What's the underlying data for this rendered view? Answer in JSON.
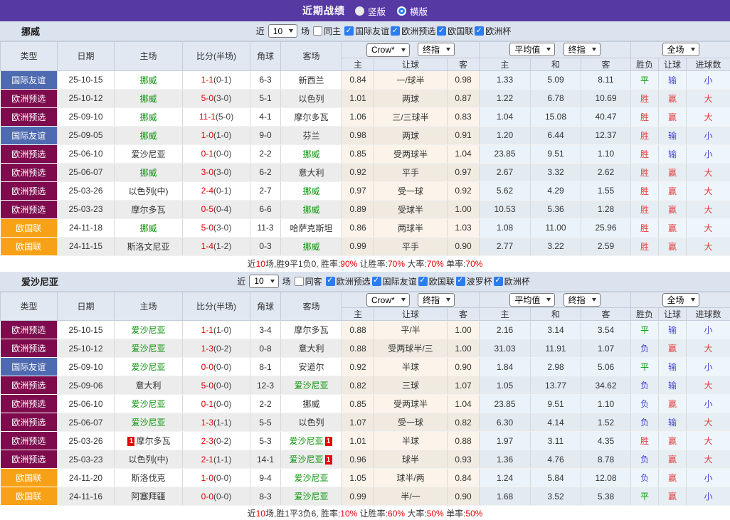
{
  "title_bar": {
    "title": "近期战绩",
    "options": [
      {
        "label": "竖版",
        "selected": true
      },
      {
        "label": "横版",
        "selected": false
      }
    ]
  },
  "colors": {
    "titlebar_bg": "#5639a3",
    "filterbar_bg": "#dbe3ee",
    "header_bg": "#e1e8f2",
    "checkbox_accent": "#2b7cf0",
    "badge": {
      "国际友谊": "#4e6ab0",
      "欧洲预选": "#7d0b4d",
      "欧国联": "#f7a216"
    },
    "team_highlight": "#089408",
    "score_red": "#e60000",
    "result_win": "#e03e3e",
    "result_draw": "#089408",
    "result_loss": "#4444d4"
  },
  "sections": [
    {
      "team": "挪威",
      "filter": {
        "near": "近",
        "count": "10",
        "unit": "场",
        "same_label": "同主",
        "same_checked": false,
        "competitions": [
          {
            "label": "国际友谊",
            "checked": true
          },
          {
            "label": "欧洲预选",
            "checked": true
          },
          {
            "label": "欧国联",
            "checked": true
          },
          {
            "label": "欧洲杯",
            "checked": true
          }
        ]
      },
      "header": {
        "col_type": "类型",
        "col_date": "日期",
        "col_home": "主场",
        "col_score": "比分(半场)",
        "col_corner": "角球",
        "col_away": "客场",
        "select_crow": "Crow*",
        "select_final1": "终指",
        "select_avg": "平均值",
        "select_final2": "终指",
        "select_scope": "全场",
        "sub_home": "主",
        "sub_handicap": "让球",
        "sub_away": "客",
        "sub_avg_home": "主",
        "sub_avg_draw": "和",
        "sub_avg_away": "客",
        "sub_result": "胜负",
        "sub_handicap_result": "让球",
        "sub_goals": "进球数"
      },
      "rows": [
        {
          "type": "国际友谊",
          "date": "25-10-15",
          "home": "挪威",
          "home_green": true,
          "home_red": "",
          "score": "1-1",
          "half": "(0-1)",
          "corners": "6-3",
          "away": "新西兰",
          "away_green": false,
          "away_red": "",
          "odds_home": "0.84",
          "handicap": "一/球半",
          "odds_away": "0.98",
          "avg_home": "1.33",
          "avg_draw": "5.09",
          "avg_away": "8.11",
          "result": "平",
          "handicap_result": "输",
          "goals": "小"
        },
        {
          "type": "欧洲预选",
          "date": "25-10-12",
          "home": "挪威",
          "home_green": true,
          "home_red": "",
          "score": "5-0",
          "half": "(3-0)",
          "corners": "5-1",
          "away": "以色列",
          "away_green": false,
          "away_red": "",
          "odds_home": "1.01",
          "handicap": "两球",
          "odds_away": "0.87",
          "avg_home": "1.22",
          "avg_draw": "6.78",
          "avg_away": "10.69",
          "result": "胜",
          "handicap_result": "赢",
          "goals": "大"
        },
        {
          "type": "欧洲预选",
          "date": "25-09-10",
          "home": "挪威",
          "home_green": true,
          "home_red": "",
          "score": "11-1",
          "half": "(5-0)",
          "corners": "4-1",
          "away": "摩尔多瓦",
          "away_green": false,
          "away_red": "",
          "odds_home": "1.06",
          "handicap": "三/三球半",
          "odds_away": "0.83",
          "avg_home": "1.04",
          "avg_draw": "15.08",
          "avg_away": "40.47",
          "result": "胜",
          "handicap_result": "赢",
          "goals": "大"
        },
        {
          "type": "国际友谊",
          "date": "25-09-05",
          "home": "挪威",
          "home_green": true,
          "home_red": "",
          "score": "1-0",
          "half": "(1-0)",
          "corners": "9-0",
          "away": "芬兰",
          "away_green": false,
          "away_red": "",
          "odds_home": "0.98",
          "handicap": "两球",
          "odds_away": "0.91",
          "avg_home": "1.20",
          "avg_draw": "6.44",
          "avg_away": "12.37",
          "result": "胜",
          "handicap_result": "输",
          "goals": "小"
        },
        {
          "type": "欧洲预选",
          "date": "25-06-10",
          "home": "爱沙尼亚",
          "home_green": false,
          "home_red": "",
          "score": "0-1",
          "half": "(0-0)",
          "corners": "2-2",
          "away": "挪威",
          "away_green": true,
          "away_red": "",
          "odds_home": "0.85",
          "handicap": "受两球半",
          "odds_away": "1.04",
          "avg_home": "23.85",
          "avg_draw": "9.51",
          "avg_away": "1.10",
          "result": "胜",
          "handicap_result": "输",
          "goals": "小"
        },
        {
          "type": "欧洲预选",
          "date": "25-06-07",
          "home": "挪威",
          "home_green": true,
          "home_red": "",
          "score": "3-0",
          "half": "(3-0)",
          "corners": "6-2",
          "away": "意大利",
          "away_green": false,
          "away_red": "",
          "odds_home": "0.92",
          "handicap": "平手",
          "odds_away": "0.97",
          "avg_home": "2.67",
          "avg_draw": "3.32",
          "avg_away": "2.62",
          "result": "胜",
          "handicap_result": "赢",
          "goals": "大"
        },
        {
          "type": "欧洲预选",
          "date": "25-03-26",
          "home": "以色列(中)",
          "home_green": false,
          "home_red": "",
          "score": "2-4",
          "half": "(0-1)",
          "corners": "2-7",
          "away": "挪威",
          "away_green": true,
          "away_red": "",
          "odds_home": "0.97",
          "handicap": "受一球",
          "odds_away": "0.92",
          "avg_home": "5.62",
          "avg_draw": "4.29",
          "avg_away": "1.55",
          "result": "胜",
          "handicap_result": "赢",
          "goals": "大"
        },
        {
          "type": "欧洲预选",
          "date": "25-03-23",
          "home": "摩尔多瓦",
          "home_green": false,
          "home_red": "",
          "score": "0-5",
          "half": "(0-4)",
          "corners": "6-6",
          "away": "挪威",
          "away_green": true,
          "away_red": "",
          "odds_home": "0.89",
          "handicap": "受球半",
          "odds_away": "1.00",
          "avg_home": "10.53",
          "avg_draw": "5.36",
          "avg_away": "1.28",
          "result": "胜",
          "handicap_result": "赢",
          "goals": "大"
        },
        {
          "type": "欧国联",
          "date": "24-11-18",
          "home": "挪威",
          "home_green": true,
          "home_red": "",
          "score": "5-0",
          "half": "(3-0)",
          "corners": "11-3",
          "away": "哈萨克斯坦",
          "away_green": false,
          "away_red": "",
          "odds_home": "0.86",
          "handicap": "两球半",
          "odds_away": "1.03",
          "avg_home": "1.08",
          "avg_draw": "11.00",
          "avg_away": "25.96",
          "result": "胜",
          "handicap_result": "赢",
          "goals": "大"
        },
        {
          "type": "欧国联",
          "date": "24-11-15",
          "home": "斯洛文尼亚",
          "home_green": false,
          "home_red": "",
          "score": "1-4",
          "half": "(1-2)",
          "corners": "0-3",
          "away": "挪威",
          "away_green": true,
          "away_red": "",
          "odds_home": "0.99",
          "handicap": "平手",
          "odds_away": "0.90",
          "avg_home": "2.77",
          "avg_draw": "3.22",
          "avg_away": "2.59",
          "result": "胜",
          "handicap_result": "赢",
          "goals": "大"
        }
      ],
      "summary_parts": [
        {
          "t": "近",
          "red": false
        },
        {
          "t": "10",
          "red": true
        },
        {
          "t": "场,胜9平1负0, 胜率:",
          "red": false
        },
        {
          "t": "90%",
          "red": true
        },
        {
          "t": " 让胜率:",
          "red": false
        },
        {
          "t": "70%",
          "red": true
        },
        {
          "t": " 大率:",
          "red": false
        },
        {
          "t": "70%",
          "red": true
        },
        {
          "t": " 单率:",
          "red": false
        },
        {
          "t": "70%",
          "red": true
        }
      ]
    },
    {
      "team": "爱沙尼亚",
      "filter": {
        "near": "近",
        "count": "10",
        "unit": "场",
        "same_label": "同客",
        "same_checked": false,
        "competitions": [
          {
            "label": "欧洲预选",
            "checked": true
          },
          {
            "label": "国际友谊",
            "checked": true
          },
          {
            "label": "欧国联",
            "checked": true
          },
          {
            "label": "波罗杯",
            "checked": true
          },
          {
            "label": "欧洲杯",
            "checked": true
          }
        ]
      },
      "header": {
        "col_type": "类型",
        "col_date": "日期",
        "col_home": "主场",
        "col_score": "比分(半场)",
        "col_corner": "角球",
        "col_away": "客场",
        "select_crow": "Crow*",
        "select_final1": "终指",
        "select_avg": "平均值",
        "select_final2": "终指",
        "select_scope": "全场",
        "sub_home": "主",
        "sub_handicap": "让球",
        "sub_away": "客",
        "sub_avg_home": "主",
        "sub_avg_draw": "和",
        "sub_avg_away": "客",
        "sub_result": "胜负",
        "sub_handicap_result": "让球",
        "sub_goals": "进球数"
      },
      "rows": [
        {
          "type": "欧洲预选",
          "date": "25-10-15",
          "home": "爱沙尼亚",
          "home_green": true,
          "home_red": "",
          "score": "1-1",
          "half": "(1-0)",
          "corners": "3-4",
          "away": "摩尔多瓦",
          "away_green": false,
          "away_red": "",
          "odds_home": "0.88",
          "handicap": "平/半",
          "odds_away": "1.00",
          "avg_home": "2.16",
          "avg_draw": "3.14",
          "avg_away": "3.54",
          "result": "平",
          "handicap_result": "输",
          "goals": "小"
        },
        {
          "type": "欧洲预选",
          "date": "25-10-12",
          "home": "爱沙尼亚",
          "home_green": true,
          "home_red": "",
          "score": "1-3",
          "half": "(0-2)",
          "corners": "0-8",
          "away": "意大利",
          "away_green": false,
          "away_red": "",
          "odds_home": "0.88",
          "handicap": "受两球半/三",
          "odds_away": "1.00",
          "avg_home": "31.03",
          "avg_draw": "11.91",
          "avg_away": "1.07",
          "result": "负",
          "handicap_result": "赢",
          "goals": "大"
        },
        {
          "type": "国际友谊",
          "date": "25-09-10",
          "home": "爱沙尼亚",
          "home_green": true,
          "home_red": "",
          "score": "0-0",
          "half": "(0-0)",
          "corners": "8-1",
          "away": "安道尔",
          "away_green": false,
          "away_red": "",
          "odds_home": "0.92",
          "handicap": "半球",
          "odds_away": "0.90",
          "avg_home": "1.84",
          "avg_draw": "2.98",
          "avg_away": "5.06",
          "result": "平",
          "handicap_result": "输",
          "goals": "小"
        },
        {
          "type": "欧洲预选",
          "date": "25-09-06",
          "home": "意大利",
          "home_green": false,
          "home_red": "",
          "score": "5-0",
          "half": "(0-0)",
          "corners": "12-3",
          "away": "爱沙尼亚",
          "away_green": true,
          "away_red": "",
          "odds_home": "0.82",
          "handicap": "三球",
          "odds_away": "1.07",
          "avg_home": "1.05",
          "avg_draw": "13.77",
          "avg_away": "34.62",
          "result": "负",
          "handicap_result": "输",
          "goals": "大"
        },
        {
          "type": "欧洲预选",
          "date": "25-06-10",
          "home": "爱沙尼亚",
          "home_green": true,
          "home_red": "",
          "score": "0-1",
          "half": "(0-0)",
          "corners": "2-2",
          "away": "挪威",
          "away_green": false,
          "away_red": "",
          "odds_home": "0.85",
          "handicap": "受两球半",
          "odds_away": "1.04",
          "avg_home": "23.85",
          "avg_draw": "9.51",
          "avg_away": "1.10",
          "result": "负",
          "handicap_result": "赢",
          "goals": "小"
        },
        {
          "type": "欧洲预选",
          "date": "25-06-07",
          "home": "爱沙尼亚",
          "home_green": true,
          "home_red": "",
          "score": "1-3",
          "half": "(1-1)",
          "corners": "5-5",
          "away": "以色列",
          "away_green": false,
          "away_red": "",
          "odds_home": "1.07",
          "handicap": "受一球",
          "odds_away": "0.82",
          "avg_home": "6.30",
          "avg_draw": "4.14",
          "avg_away": "1.52",
          "result": "负",
          "handicap_result": "输",
          "goals": "大"
        },
        {
          "type": "欧洲预选",
          "date": "25-03-26",
          "home": "摩尔多瓦",
          "home_green": false,
          "home_red": "1",
          "score": "2-3",
          "half": "(0-2)",
          "corners": "5-3",
          "away": "爱沙尼亚",
          "away_green": true,
          "away_red": "1",
          "odds_home": "1.01",
          "handicap": "半球",
          "odds_away": "0.88",
          "avg_home": "1.97",
          "avg_draw": "3.11",
          "avg_away": "4.35",
          "result": "胜",
          "handicap_result": "赢",
          "goals": "大"
        },
        {
          "type": "欧洲预选",
          "date": "25-03-23",
          "home": "以色列(中)",
          "home_green": false,
          "home_red": "",
          "score": "2-1",
          "half": "(1-1)",
          "corners": "14-1",
          "away": "爱沙尼亚",
          "away_green": true,
          "away_red": "1",
          "odds_home": "0.96",
          "handicap": "球半",
          "odds_away": "0.93",
          "avg_home": "1.36",
          "avg_draw": "4.76",
          "avg_away": "8.78",
          "result": "负",
          "handicap_result": "赢",
          "goals": "大"
        },
        {
          "type": "欧国联",
          "date": "24-11-20",
          "home": "斯洛伐克",
          "home_green": false,
          "home_red": "",
          "score": "1-0",
          "half": "(0-0)",
          "corners": "9-4",
          "away": "爱沙尼亚",
          "away_green": true,
          "away_red": "",
          "odds_home": "1.05",
          "handicap": "球半/两",
          "odds_away": "0.84",
          "avg_home": "1.24",
          "avg_draw": "5.84",
          "avg_away": "12.08",
          "result": "负",
          "handicap_result": "赢",
          "goals": "小"
        },
        {
          "type": "欧国联",
          "date": "24-11-16",
          "home": "阿塞拜疆",
          "home_green": false,
          "home_red": "",
          "score": "0-0",
          "half": "(0-0)",
          "corners": "8-3",
          "away": "爱沙尼亚",
          "away_green": true,
          "away_red": "",
          "odds_home": "0.99",
          "handicap": "半/一",
          "odds_away": "0.90",
          "avg_home": "1.68",
          "avg_draw": "3.52",
          "avg_away": "5.38",
          "result": "平",
          "handicap_result": "赢",
          "goals": "小"
        }
      ],
      "summary_parts": [
        {
          "t": "近",
          "red": false
        },
        {
          "t": "10",
          "red": true
        },
        {
          "t": "场,胜1平3负6, 胜率:",
          "red": false
        },
        {
          "t": "10%",
          "red": true
        },
        {
          "t": " 让胜率:",
          "red": false
        },
        {
          "t": "60%",
          "red": true
        },
        {
          "t": " 大率:",
          "red": false
        },
        {
          "t": "50%",
          "red": true
        },
        {
          "t": " 单率:",
          "red": false
        },
        {
          "t": "50%",
          "red": true
        }
      ]
    }
  ]
}
